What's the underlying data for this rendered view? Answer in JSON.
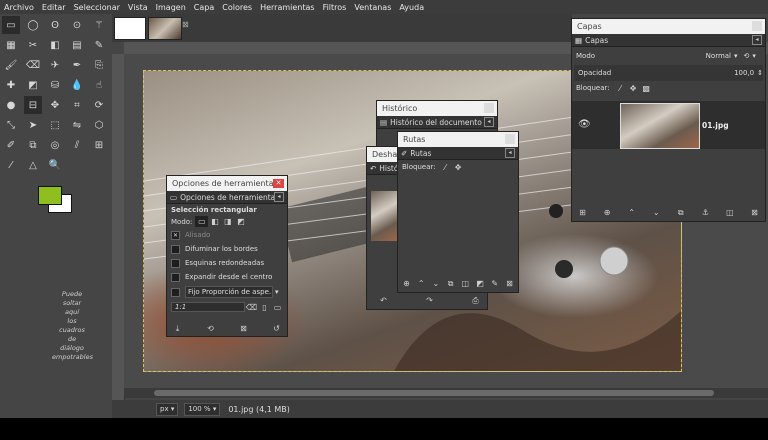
{
  "menu": [
    "Archivo",
    "Editar",
    "Seleccionar",
    "Vista",
    "Imagen",
    "Capa",
    "Colores",
    "Herramientas",
    "Filtros",
    "Ventanas",
    "Ayuda"
  ],
  "toolbox": {
    "drop_hint": [
      "Puede",
      "soltar",
      "aquí",
      "los",
      "cuadros",
      "de",
      "diálogo",
      "empotrables"
    ],
    "fg_color": "#8fbf1f",
    "bg_color": "#ffffff"
  },
  "status": {
    "unit": "px",
    "zoom": "100 %",
    "file_info": "01.jpg (4,1 MB)"
  },
  "layers_panel": {
    "title": "Capas",
    "tab": "Capas",
    "mode_label": "Modo",
    "mode_value": "Normal",
    "opacity_label": "Opacidad",
    "opacity_value": "100,0",
    "lock_label": "Bloquear:",
    "layer_name": "01.jpg"
  },
  "history_panel": {
    "title": "Histórico",
    "tab": "Histórico del documento"
  },
  "undo_panel": {
    "title": "Deshac",
    "tab": "Histórico"
  },
  "paths_panel": {
    "title": "Rutas",
    "tab": "Rutas",
    "lock_label": "Bloquear:"
  },
  "tool_options": {
    "title": "Opciones de herramienta",
    "tab": "Opciones de herramienta",
    "tool_name": "Selección rectangular",
    "mode_label": "Modo:",
    "options": [
      {
        "label": "Alisado",
        "checked": true,
        "dim": true
      },
      {
        "label": "Difuminar los bordes",
        "checked": false,
        "dim": false
      },
      {
        "label": "Esquinas redondeadas",
        "checked": false,
        "dim": false
      },
      {
        "label": "Expandir desde el centro",
        "checked": false,
        "dim": false
      }
    ],
    "fixed_label": "Fijo Proporción de aspe...",
    "ratio_value": "1:1"
  }
}
